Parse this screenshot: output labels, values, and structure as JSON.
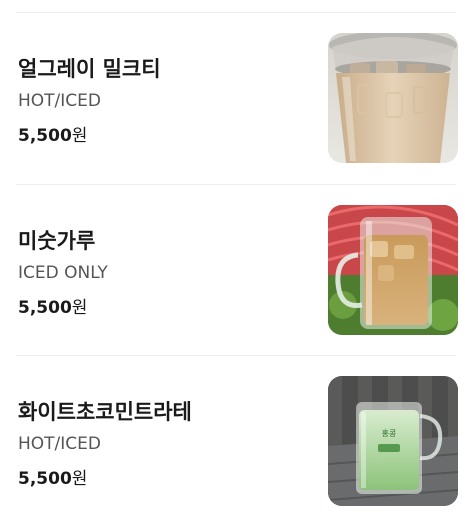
{
  "menu": {
    "items": [
      {
        "name": "얼그레이 밀크티",
        "option": "HOT/ICED",
        "price": "5,500",
        "currency": "원",
        "image_icon": "iced-milk-tea-cup-photo"
      },
      {
        "name": "미숫가루",
        "option": "ICED ONLY",
        "price": "5,500",
        "currency": "원",
        "image_icon": "iced-misutgaru-mug-photo"
      },
      {
        "name": "화이트초코민트라테",
        "option": "HOT/ICED",
        "price": "5,500",
        "currency": "원",
        "image_icon": "mint-latte-glass-photo",
        "image_cup_text": "홍콩"
      }
    ]
  }
}
